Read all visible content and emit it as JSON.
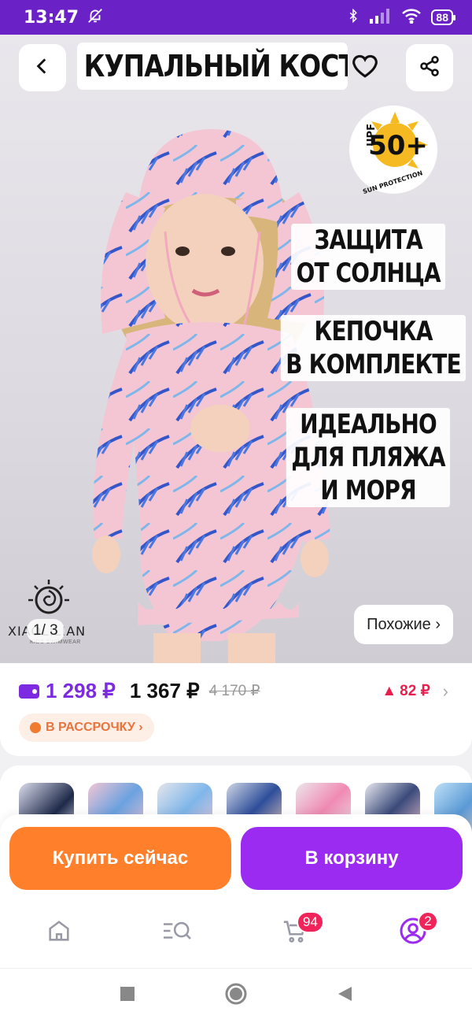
{
  "status_bar": {
    "time": "13:47",
    "battery": "88"
  },
  "hero": {
    "title": "КУПАЛЬНЫЙ КОСТЮМ",
    "upf_badge": {
      "upf": "UPF",
      "value": "50+",
      "caption": "SUN PROTECTION"
    },
    "labels": [
      {
        "line1": "ЗАЩИТА",
        "line2": "ОТ СОЛНЦА"
      },
      {
        "line1": "КЕПОЧКА",
        "line2": "В КОМПЛЕКТЕ"
      },
      {
        "line1": "ИДЕАЛЬНО",
        "line2": "ДЛЯ ПЛЯЖА",
        "line3": "И МОРЯ"
      }
    ],
    "brand": {
      "name": "XIAOLILIAN",
      "sub": "KIDS SWIMWEAR"
    },
    "page_indicator": "1/ 3",
    "similar_label": "Похожие ›"
  },
  "price": {
    "card_price": "1 298 ₽",
    "price": "1 367 ₽",
    "old_price": "4 170 ₽",
    "points": "82 ₽",
    "installment_label": "В РАССРОЧКУ ›"
  },
  "actions": {
    "buy_now": "Купить сейчас",
    "add_to_cart": "В корзину"
  },
  "bottom_nav": {
    "cart_badge": "94",
    "profile_badge": "2"
  },
  "colors": {
    "status_bar": "#6a22c6",
    "accent_purple": "#9b2bf1",
    "buy_orange": "#ff7f2a",
    "card_price": "#7c2be0",
    "badge_red": "#f0245a"
  },
  "icons": [
    "back-arrow-icon",
    "heart-icon",
    "share-icon",
    "home-icon",
    "catalog-search-icon",
    "cart-icon",
    "profile-icon",
    "square-icon",
    "circle-icon",
    "triangle-back-icon"
  ]
}
